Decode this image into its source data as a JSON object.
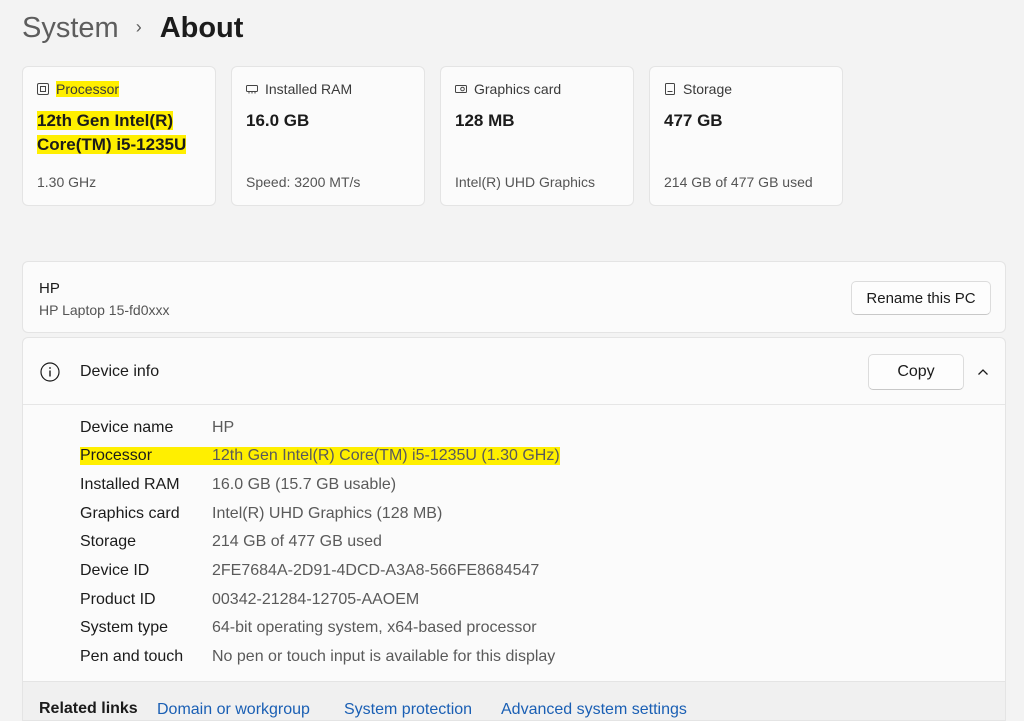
{
  "breadcrumb": {
    "parent": "System",
    "separator": "›",
    "current": "About"
  },
  "cards": [
    {
      "icon": "processor-icon",
      "label": "Processor",
      "value": "12th Gen Intel(R) Core(TM) i5-1235U",
      "value_line1": "12th Gen Intel(R)",
      "value_line2": "Core(TM) i5-1235U",
      "sub": "1.30 GHz",
      "highlighted": true
    },
    {
      "icon": "ram-icon",
      "label": "Installed RAM",
      "value": "16.0 GB",
      "sub": "Speed: 3200 MT/s"
    },
    {
      "icon": "graphics-card-icon",
      "label": "Graphics card",
      "value": "128 MB",
      "sub": "Intel(R) UHD Graphics"
    },
    {
      "icon": "storage-icon",
      "label": "Storage",
      "value": "477 GB",
      "sub": "214 GB of 477 GB used"
    }
  ],
  "pc": {
    "name": "HP",
    "model": "HP Laptop 15-fd0xxx",
    "rename_label": "Rename this PC"
  },
  "device_info": {
    "title": "Device info",
    "copy_label": "Copy",
    "rows": [
      {
        "key": "Device name",
        "value": "HP"
      },
      {
        "key": "Processor",
        "value": "12th Gen Intel(R) Core(TM) i5-1235U (1.30 GHz)",
        "highlighted": true
      },
      {
        "key": "Installed RAM",
        "value": "16.0 GB (15.7 GB usable)"
      },
      {
        "key": "Graphics card",
        "value": "Intel(R) UHD Graphics (128 MB)"
      },
      {
        "key": "Storage",
        "value": "214 GB of 477 GB used"
      },
      {
        "key": "Device ID",
        "value": "2FE7684A-2D91-4DCD-A3A8-566FE8684547"
      },
      {
        "key": "Product ID",
        "value": "00342-21284-12705-AAOEM"
      },
      {
        "key": "System type",
        "value": "64-bit operating system, x64-based processor"
      },
      {
        "key": "Pen and touch",
        "value": "No pen or touch input is available for this display"
      }
    ]
  },
  "related_links": {
    "label": "Related links",
    "links": [
      "Domain or workgroup",
      "System protection",
      "Advanced system settings"
    ]
  },
  "colors": {
    "highlight": "#ffef00",
    "link": "#1a5fb4",
    "background": "#f3f3f3",
    "card": "#fbfbfb"
  }
}
